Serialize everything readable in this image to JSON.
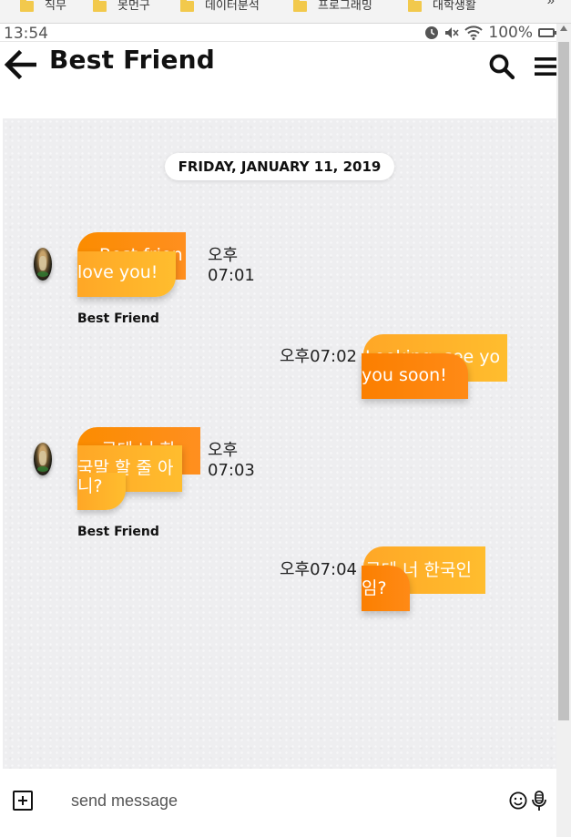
{
  "browser": {
    "bookmarks": [
      "직무",
      "못먼구",
      "데이터분석",
      "프로그래밍",
      "대학생활"
    ],
    "more": "»"
  },
  "status_bar": {
    "time": "13:54",
    "battery": "100%"
  },
  "header": {
    "title": "Best Friend"
  },
  "chat": {
    "date_label": "FRIDAY, JANUARY 11, 2019",
    "messages": [
      {
        "direction": "incoming",
        "back_text": "Best friends i",
        "text": "love you!",
        "time": "오후 07:01",
        "sender": "Best Friend"
      },
      {
        "direction": "outgoing",
        "back_text": "Looking, see you see",
        "text": "you soon!",
        "time": "오후07:02"
      },
      {
        "direction": "incoming",
        "back_text": "근데 너 한",
        "text": "국말 할 줄 아",
        "text_extra": "니?",
        "time": "오후 07:03",
        "sender": "Best Friend"
      },
      {
        "direction": "outgoing",
        "back_text": "근데 너 한국인",
        "text": "임?",
        "time": "오후07:04"
      }
    ]
  },
  "composer": {
    "placeholder": "send message"
  },
  "colors": {
    "accent_orange": "#fb8c00",
    "accent_yellow": "#ffbd2e",
    "chat_bg": "#eeeef0"
  }
}
